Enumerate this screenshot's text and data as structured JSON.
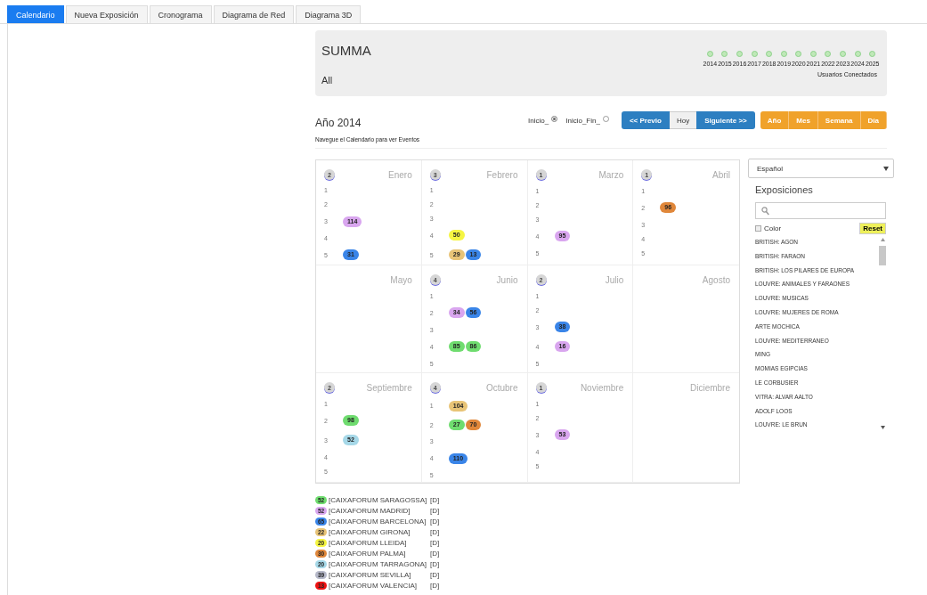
{
  "tabs": [
    {
      "label": "Calendario",
      "selected": true
    },
    {
      "label": "Nueva Exposición",
      "selected": false
    },
    {
      "label": "Cronograma",
      "selected": false
    },
    {
      "label": "Diagrama de Red",
      "selected": false
    },
    {
      "label": "Diagrama 3D",
      "selected": false
    }
  ],
  "header": {
    "title": "SUMMA",
    "subtitle": "All",
    "years": [
      "2014",
      "2015",
      "2016",
      "2017",
      "2018",
      "2019",
      "2020",
      "2021",
      "2022",
      "2023",
      "2024",
      "2025"
    ],
    "users_label": "Usuarios Conectados"
  },
  "toolbar": {
    "year_title": "Año 2014",
    "hint": "Navegue el Calendario para ver Eventos",
    "radios": [
      {
        "label": "Inicio_",
        "selected": true
      },
      {
        "label": "Inicio_Fin_",
        "selected": false
      }
    ],
    "nav_buttons": [
      {
        "label": "<< Previo",
        "kind": "primary"
      },
      {
        "label": "Hoy",
        "kind": "plain"
      },
      {
        "label": "Siguiente >>",
        "kind": "primary"
      }
    ],
    "view_buttons": [
      {
        "label": "Año"
      },
      {
        "label": "Mes"
      },
      {
        "label": "Semana"
      },
      {
        "label": "Día"
      }
    ]
  },
  "months": [
    {
      "name": "Enero",
      "count": "2",
      "days": [
        {
          "label": "1"
        },
        {
          "label": "2"
        },
        {
          "label": "3",
          "events": [
            {
              "text": "114",
              "color": "#d9a6ef"
            }
          ]
        },
        {
          "label": "4"
        },
        {
          "label": "5",
          "events": [
            {
              "text": "31",
              "color": "#3a85e8"
            }
          ]
        }
      ]
    },
    {
      "name": "Febrero",
      "count": "3",
      "days": [
        {
          "label": "1"
        },
        {
          "label": "2"
        },
        {
          "label": "3"
        },
        {
          "label": "4",
          "events": [
            {
              "text": "50",
              "color": "#f5f542"
            }
          ]
        },
        {
          "label": "5",
          "events": [
            {
              "text": "29",
              "color": "#e8c477"
            },
            {
              "text": "13",
              "color": "#3a85e8"
            }
          ]
        }
      ]
    },
    {
      "name": "Marzo",
      "count": "1",
      "days": [
        {
          "label": "1"
        },
        {
          "label": "2"
        },
        {
          "label": "3"
        },
        {
          "label": "4",
          "events": [
            {
              "text": "95",
              "color": "#d9a6ef"
            }
          ]
        },
        {
          "label": "5"
        }
      ]
    },
    {
      "name": "Abril",
      "count": "1",
      "days": [
        {
          "label": "1"
        },
        {
          "label": "2",
          "events": [
            {
              "text": "96",
              "color": "#e0873a"
            }
          ]
        },
        {
          "label": "3"
        },
        {
          "label": "4"
        },
        {
          "label": "5"
        }
      ]
    },
    {
      "name": "Mayo"
    },
    {
      "name": "Junio",
      "count": "4",
      "days": [
        {
          "label": "1"
        },
        {
          "label": "2",
          "events": [
            {
              "text": "34",
              "color": "#d9a6ef"
            },
            {
              "text": "56",
              "color": "#3a85e8"
            }
          ]
        },
        {
          "label": "3"
        },
        {
          "label": "4",
          "events": [
            {
              "text": "85",
              "color": "#6fdc6f"
            },
            {
              "text": "86",
              "color": "#6fdc6f"
            }
          ]
        },
        {
          "label": "5"
        }
      ]
    },
    {
      "name": "Julio",
      "count": "2",
      "days": [
        {
          "label": "1"
        },
        {
          "label": "2"
        },
        {
          "label": "3",
          "events": [
            {
              "text": "38",
              "color": "#3a85e8"
            }
          ]
        },
        {
          "label": "4",
          "events": [
            {
              "text": "16",
              "color": "#d9a6ef"
            }
          ]
        },
        {
          "label": "5"
        }
      ]
    },
    {
      "name": "Agosto"
    },
    {
      "name": "Septiembre",
      "count": "2",
      "days": [
        {
          "label": "1"
        },
        {
          "label": "2",
          "events": [
            {
              "text": "98",
              "color": "#6fdc6f"
            }
          ]
        },
        {
          "label": "3",
          "events": [
            {
              "text": "52",
              "color": "#a6d8e8"
            }
          ]
        },
        {
          "label": "4"
        },
        {
          "label": "5"
        }
      ]
    },
    {
      "name": "Octubre",
      "count": "4",
      "days": [
        {
          "label": "1",
          "events": [
            {
              "text": "104",
              "color": "#e8c477"
            }
          ]
        },
        {
          "label": "2",
          "events": [
            {
              "text": "27",
              "color": "#6fdc6f"
            },
            {
              "text": "70",
              "color": "#e0873a"
            }
          ]
        },
        {
          "label": "3"
        },
        {
          "label": "4",
          "events": [
            {
              "text": "110",
              "color": "#3a85e8"
            }
          ]
        },
        {
          "label": "5"
        }
      ]
    },
    {
      "name": "Noviembre",
      "count": "1",
      "days": [
        {
          "label": "1"
        },
        {
          "label": "2"
        },
        {
          "label": "3",
          "events": [
            {
              "text": "53",
              "color": "#d9a6ef"
            }
          ]
        },
        {
          "label": "4"
        },
        {
          "label": "5"
        }
      ]
    },
    {
      "name": "Diciembre"
    }
  ],
  "sidebar": {
    "language": "Español",
    "title": "Exposiciones",
    "color_label": "Color",
    "color_checked": false,
    "reset": "Reset",
    "items": [
      "BRITISH: AGON",
      "BRITISH: FARAON",
      "BRITISH: LOS PILARES DE EUROPA",
      "LOUVRE: ANIMALES Y FARAONES",
      "LOUVRE: MUSICAS",
      "LOUVRE: MUJERES DE ROMA",
      "ARTE MOCHICA",
      "LOUVRE: MEDITERRANEO",
      "MING",
      "MOMIAS EGIPCIAS",
      "LE CORBUSIER",
      "VITRA: ALVAR AALTO",
      "ADOLF LOOS",
      "LOUVRE: LE BRUN"
    ]
  },
  "legend": [
    {
      "count": "52",
      "name": "[CAIXAFORUM SARAGOSSA]",
      "tag": "[D]",
      "color": "#6fdc6f"
    },
    {
      "count": "52",
      "name": "[CAIXAFORUM MADRID]",
      "tag": "[D]",
      "color": "#d9a6ef"
    },
    {
      "count": "65",
      "name": "[CAIXAFORUM BARCELONA]",
      "tag": "[D]",
      "color": "#3a85e8"
    },
    {
      "count": "22",
      "name": "[CAIXAFORUM GIRONA]",
      "tag": "[D]",
      "color": "#e8c477"
    },
    {
      "count": "20",
      "name": "[CAIXAFORUM LLEIDA]",
      "tag": "[D]",
      "color": "#f5f542"
    },
    {
      "count": "30",
      "name": "[CAIXAFORUM PALMA]",
      "tag": "[D]",
      "color": "#e0873a"
    },
    {
      "count": "20",
      "name": "[CAIXAFORUM TARRAGONA]",
      "tag": "[D]",
      "color": "#a6d8e8"
    },
    {
      "count": "39",
      "name": "[CAIXAFORUM SEVILLA]",
      "tag": "[D]",
      "color": "#b5b8c8"
    },
    {
      "count": "13",
      "name": "[CAIXAFORUM VALENCIA]",
      "tag": "[D]",
      "color": "#ee1111"
    }
  ]
}
